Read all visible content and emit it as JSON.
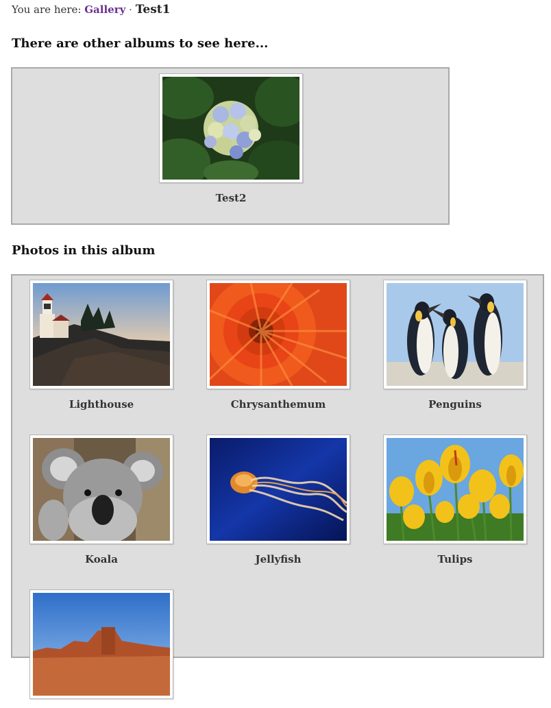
{
  "breadcrumb": {
    "prefix": "You are here:",
    "gallery_link": "Gallery",
    "separator": "·",
    "current": "Test1"
  },
  "albums_section": {
    "heading": "There are other albums to see here...",
    "albums": [
      {
        "name": "Test2",
        "thumb": "flower-hydrangea"
      }
    ]
  },
  "photos_section": {
    "heading": "Photos in this album",
    "photos": [
      {
        "name": "Lighthouse",
        "thumb": "lighthouse"
      },
      {
        "name": "Chrysanthemum",
        "thumb": "chrysanthemum"
      },
      {
        "name": "Penguins",
        "thumb": "penguins"
      },
      {
        "name": "Koala",
        "thumb": "koala"
      },
      {
        "name": "Jellyfish",
        "thumb": "jellyfish"
      },
      {
        "name": "Tulips",
        "thumb": "tulips"
      },
      {
        "name": "",
        "thumb": "desert"
      }
    ]
  },
  "colors": {
    "link": "#6b2f92",
    "panel_bg": "#dedede",
    "panel_border": "#a9a9a9"
  }
}
